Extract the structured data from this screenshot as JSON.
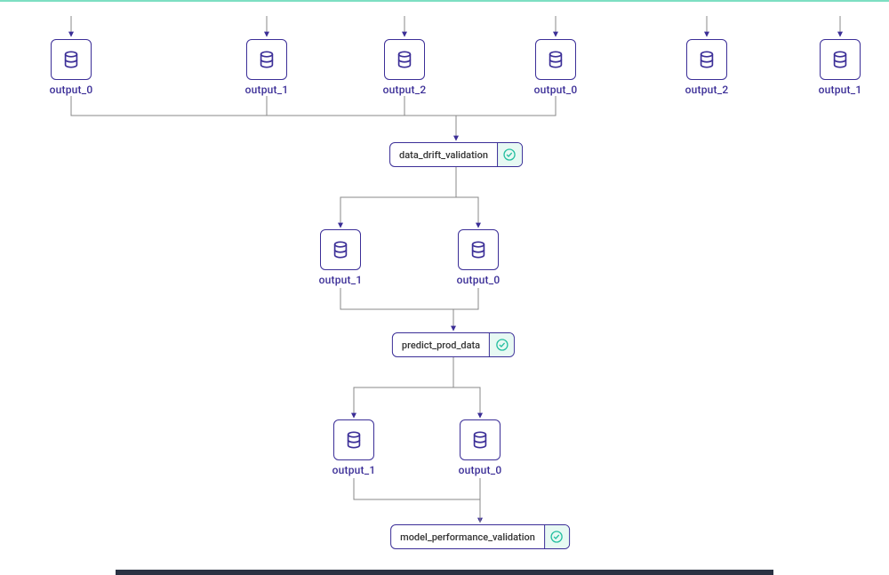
{
  "colors": {
    "node_border": "#3b2e97",
    "label": "#3b2e97",
    "edge": "#888888",
    "status_bg": "#e7f9f3",
    "status_ring": "#24bfa0"
  },
  "nodes": {
    "top_outputs": [
      {
        "id": "top-out-0",
        "label": "output_0"
      },
      {
        "id": "top-out-1",
        "label": "output_1"
      },
      {
        "id": "top-out-2",
        "label": "output_2"
      },
      {
        "id": "top-out-3",
        "label": "output_0"
      },
      {
        "id": "top-out-4",
        "label": "output_2"
      },
      {
        "id": "top-out-5",
        "label": "output_1"
      }
    ],
    "step1": {
      "label": "data_drift_validation",
      "status": "success"
    },
    "step1_outputs": [
      {
        "id": "s1-out-a",
        "label": "output_1"
      },
      {
        "id": "s1-out-b",
        "label": "output_0"
      }
    ],
    "step2": {
      "label": "predict_prod_data",
      "status": "success"
    },
    "step2_outputs": [
      {
        "id": "s2-out-a",
        "label": "output_1"
      },
      {
        "id": "s2-out-b",
        "label": "output_0"
      }
    ],
    "step3": {
      "label": "model_performance_validation",
      "status": "success"
    }
  }
}
